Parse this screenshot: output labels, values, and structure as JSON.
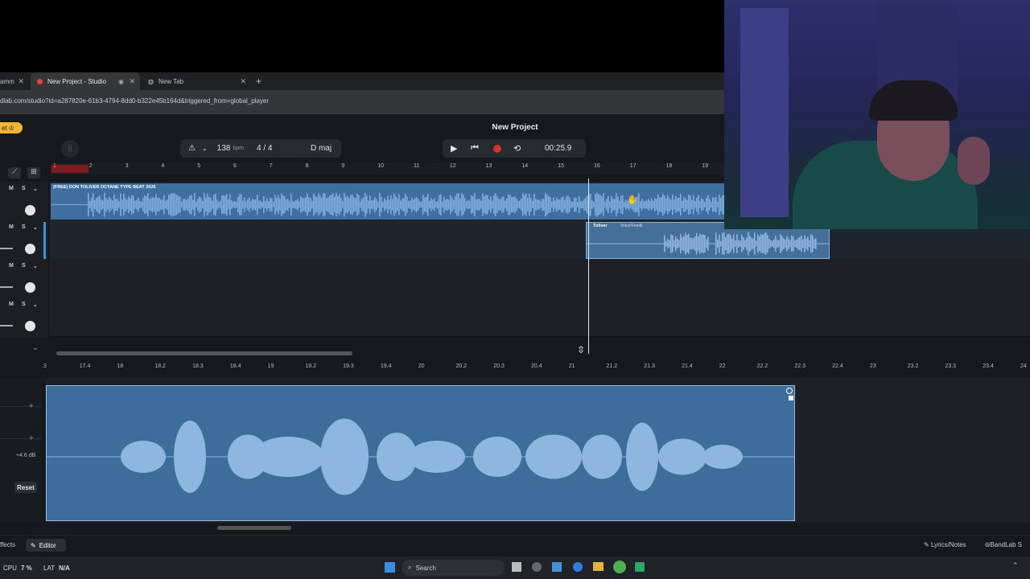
{
  "browser": {
    "tabs": [
      {
        "label": "amm"
      },
      {
        "label": "New Project - Studio"
      },
      {
        "label": "New Tab"
      }
    ],
    "url": "dlab.com/studio?id=a287820e-61b3-4794-8dd0-b322e45b164d&triggered_from=global_player"
  },
  "app": {
    "project_title": "New Project",
    "left_badge": "et",
    "tempo_value": "138",
    "tempo_unit": "bpm",
    "time_signature": "4 / 4",
    "key": "D maj",
    "time_display": "00:25.9"
  },
  "timeline": {
    "ruler_top": [
      "1",
      "2",
      "3",
      "4",
      "5",
      "6",
      "7",
      "8",
      "9",
      "10",
      "11",
      "12",
      "13",
      "14",
      "15",
      "16",
      "17",
      "18",
      "19"
    ],
    "ruler_editor": [
      ".3",
      "17.4",
      "18",
      "18.2",
      "18.3",
      "18.4",
      "19",
      "19.2",
      "19.3",
      "19.4",
      "20",
      "20.2",
      "20.3",
      "20.4",
      "21",
      "21.2",
      "21.3",
      "21.4",
      "22",
      "22.2",
      "22.3",
      "22.4",
      "23",
      "23.2",
      "23.3",
      "23.4",
      "24"
    ]
  },
  "tracks": {
    "clip1_title": "(FREE) DON TOLIVER OCTANE TYPE BEAT 2026",
    "clip2_title": "Toliver",
    "clip2_subtitle": "Voice/Feedb"
  },
  "editor": {
    "gain_label": "+4.6 dB",
    "reset_label": "Reset"
  },
  "bottom": {
    "effects_label": "ffects",
    "editor_label": "Editor",
    "lyrics_label": "Lyrics/Notes",
    "bandlab_label": "BandLab S"
  },
  "taskbar": {
    "cpu_label": "CPU",
    "cpu_value": "7 %",
    "lat_label": "LAT",
    "lat_value": "N/A",
    "search_placeholder": "Search"
  },
  "colors": {
    "clip_blue": "#3e6f9e",
    "record_red": "#d9302c",
    "app_bg": "#15181d"
  }
}
